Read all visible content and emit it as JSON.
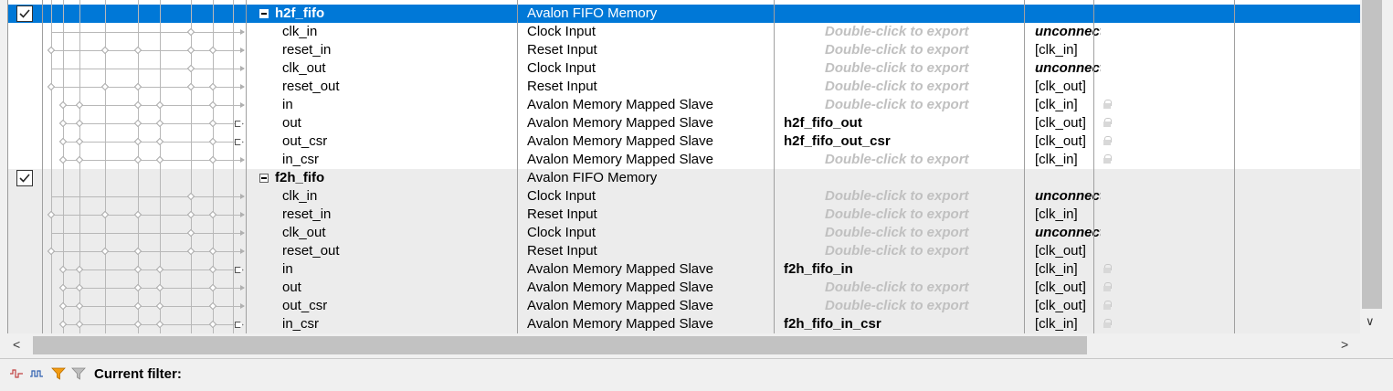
{
  "hints": {
    "export": "Double-click to export"
  },
  "colors": {
    "selection": "#0078d7",
    "hint_text": "#c0c0c0",
    "group_bg": "#ececec"
  },
  "rows": [
    {
      "kind": "group",
      "name": "h2f_fifo",
      "desc": "Avalon FIFO Memory",
      "checked": true,
      "selected": true,
      "export": "",
      "clock": ""
    },
    {
      "kind": "port",
      "name": "clk_in",
      "desc": "Clock Input",
      "export": "",
      "clock": "unconnected"
    },
    {
      "kind": "port",
      "name": "reset_in",
      "desc": "Reset Input",
      "export": "",
      "clock": "[clk_in]"
    },
    {
      "kind": "port",
      "name": "clk_out",
      "desc": "Clock Input",
      "export": "",
      "clock": "unconnected"
    },
    {
      "kind": "port",
      "name": "reset_out",
      "desc": "Reset Input",
      "export": "",
      "clock": "[clk_out]"
    },
    {
      "kind": "port",
      "name": "in",
      "desc": "Avalon Memory Mapped Slave",
      "export": "",
      "clock": "[clk_in]"
    },
    {
      "kind": "port",
      "name": "out",
      "desc": "Avalon Memory Mapped Slave",
      "export": "h2f_fifo_out",
      "clock": "[clk_out]"
    },
    {
      "kind": "port",
      "name": "out_csr",
      "desc": "Avalon Memory Mapped Slave",
      "export": "h2f_fifo_out_csr",
      "clock": "[clk_out]"
    },
    {
      "kind": "port",
      "name": "in_csr",
      "desc": "Avalon Memory Mapped Slave",
      "export": "",
      "clock": "[clk_in]"
    },
    {
      "kind": "group",
      "name": "f2h_fifo",
      "desc": "Avalon FIFO Memory",
      "checked": true,
      "selected": false,
      "export": "",
      "clock": ""
    },
    {
      "kind": "port",
      "name": "clk_in",
      "desc": "Clock Input",
      "export": "",
      "clock": "unconnected"
    },
    {
      "kind": "port",
      "name": "reset_in",
      "desc": "Reset Input",
      "export": "",
      "clock": "[clk_in]"
    },
    {
      "kind": "port",
      "name": "clk_out",
      "desc": "Clock Input",
      "export": "",
      "clock": "unconnected"
    },
    {
      "kind": "port",
      "name": "reset_out",
      "desc": "Reset Input",
      "export": "",
      "clock": "[clk_out]"
    },
    {
      "kind": "port",
      "name": "in",
      "desc": "Avalon Memory Mapped Slave",
      "export": "f2h_fifo_in",
      "clock": "[clk_in]"
    },
    {
      "kind": "port",
      "name": "out",
      "desc": "Avalon Memory Mapped Slave",
      "export": "",
      "clock": "[clk_out]"
    },
    {
      "kind": "port",
      "name": "out_csr",
      "desc": "Avalon Memory Mapped Slave",
      "export": "",
      "clock": "[clk_out]"
    },
    {
      "kind": "port",
      "name": "in_csr",
      "desc": "Avalon Memory Mapped Slave",
      "export": "f2h_fifo_in_csr",
      "clock": "[clk_in]"
    }
  ],
  "footer": {
    "filter_label": "Current filter:",
    "icons": [
      "show-signals-icon",
      "show-clocks-icon",
      "filter-icon",
      "clear-filter-icon"
    ]
  }
}
